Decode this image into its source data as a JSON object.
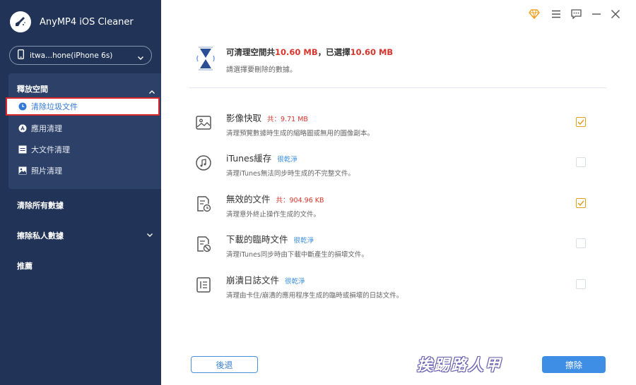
{
  "app": {
    "title": "AnyMP4 iOS Cleaner"
  },
  "device": {
    "name": "itwa...hone(iPhone 6s)"
  },
  "sidebar": {
    "free_space": {
      "title": "釋放空間",
      "items": [
        {
          "label": "清除垃圾文件",
          "icon": "clock-icon",
          "active": true
        },
        {
          "label": "應用清理",
          "icon": "app-store-icon",
          "active": false
        },
        {
          "label": "大文件清理",
          "icon": "document-icon",
          "active": false
        },
        {
          "label": "照片清理",
          "icon": "image-icon",
          "active": false
        }
      ]
    },
    "nav": [
      {
        "label": "清除所有數據"
      },
      {
        "label": "擦除私人數據"
      },
      {
        "label": "推薦"
      }
    ]
  },
  "topbar": {
    "icons": [
      "diamond-icon",
      "menu-icon",
      "feedback-icon",
      "minimize-icon",
      "close-icon"
    ]
  },
  "summary": {
    "prefix": "可清理空間共",
    "total": "10.60 MB",
    "middle": "，已選擇",
    "selected": "10.60 MB",
    "subtitle": "請選擇要刪除的數據。"
  },
  "items": [
    {
      "name": "影像快取",
      "tag": "共：9.71 MB",
      "tag_type": "size",
      "desc": "清理預覽數據時生成的縮略圖或無用的圖像副本。",
      "checked": true,
      "icon": "image-icon"
    },
    {
      "name": "iTunes緩存",
      "tag": "很乾淨",
      "tag_type": "clean",
      "desc": "清理iTunes無法同步時生成的不完整文件。",
      "checked": false,
      "icon": "music-icon"
    },
    {
      "name": "無效的文件",
      "tag": "共：904.96 KB",
      "tag_type": "size",
      "desc": "清理意外終止操作生成的文件。",
      "checked": true,
      "icon": "file-clock-icon"
    },
    {
      "name": "下載的臨時文件",
      "tag": "很乾淨",
      "tag_type": "clean",
      "desc": "清理iTunes同步時由下載中斷產生的損壞文件。",
      "checked": false,
      "icon": "file-blocked-icon"
    },
    {
      "name": "崩潰日誌文件",
      "tag": "很乾淨",
      "tag_type": "clean",
      "desc": "清理由卡住/崩潰的應用程序生成的臨時或損壞的日誌文件。",
      "checked": false,
      "icon": "log-file-icon"
    }
  ],
  "buttons": {
    "back": "後退",
    "clean": "擦除"
  },
  "watermark": "挨踢路人甲",
  "colors": {
    "sidebar": "#213457",
    "accent": "#3e8ee6",
    "highlight": "#d8352c",
    "check": "#e0a020"
  }
}
